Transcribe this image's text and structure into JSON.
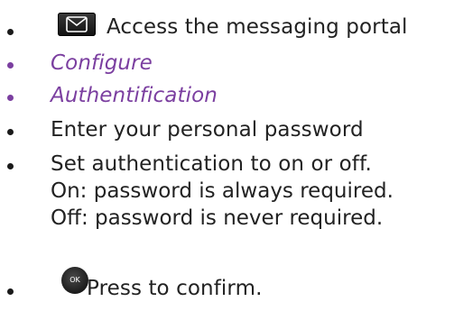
{
  "items": [
    {
      "icon": "envelope-key-icon",
      "text": "Access the messaging portal",
      "color": "#222222"
    },
    {
      "text": "Configure",
      "color": "#7b3fa0",
      "italic": true
    },
    {
      "text": "Authentification",
      "color": "#7b3fa0",
      "italic": true
    },
    {
      "text": "Enter your personal password",
      "color": "#222222"
    },
    {
      "text": "Set authentication to on or off.",
      "lines": [
        "On: password is always required.",
        "Off: password is never required."
      ],
      "color": "#222222"
    },
    {
      "icon": "ok-button-icon",
      "icon_label": "OK",
      "text": "Press to confirm.",
      "color": "#222222"
    }
  ]
}
